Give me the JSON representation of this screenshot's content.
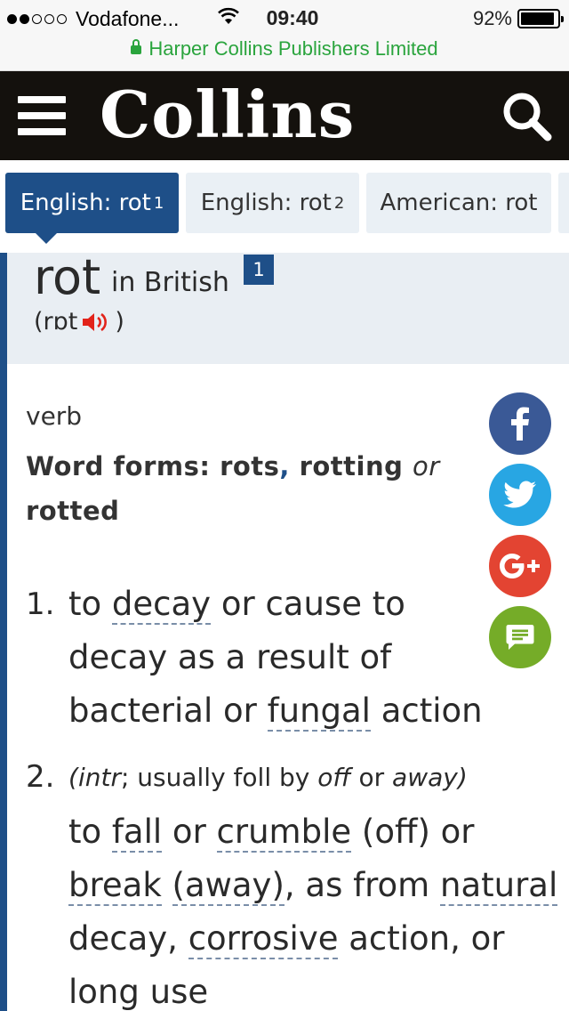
{
  "status_bar": {
    "carrier": "Vodafone...",
    "time": "09:40",
    "battery": "92%",
    "signal_bars_filled": 2,
    "signal_bars_total": 5
  },
  "url_bar": {
    "site_label": "Harper Collins Publishers Limited",
    "lock_icon": "lock-icon"
  },
  "header": {
    "logo": "Collins",
    "menu_icon": "hamburger-menu-icon",
    "search_icon": "search-icon"
  },
  "tabs": [
    {
      "label": "English: rot",
      "superscript": "1",
      "active": true
    },
    {
      "label": "English: rot",
      "superscript": "2",
      "active": false
    },
    {
      "label": "American: rot",
      "superscript": "",
      "active": false
    }
  ],
  "entry": {
    "headword": "rot",
    "region": "in British",
    "homograph": "1",
    "pronunciation_open": "(rɒt",
    "pronunciation_close": ")",
    "audio_icon": "speaker-icon"
  },
  "definition": {
    "part_of_speech": "verb",
    "word_forms_label": "Word forms:",
    "word_forms": [
      "rots",
      "rotting"
    ],
    "word_forms_separator": ",",
    "word_forms_or": "or",
    "word_forms_last": "rotted",
    "senses": [
      {
        "number": "1.",
        "line1": {
          "a": "to ",
          "link1": "decay",
          "b": " or cause to"
        },
        "line2": "decay as a result of",
        "line3": {
          "a": "bacterial or ",
          "link1": "fungal",
          "b": " action"
        }
      },
      {
        "number": "2.",
        "label": {
          "open": "(",
          "intr": "intr",
          "semicolon": "; usually foll by ",
          "off": "off",
          "or": " or ",
          "away": "away",
          "close": ")"
        },
        "line1": {
          "a": "to ",
          "link1": "fall",
          "b": " or ",
          "link2": "crumble",
          "c": " (off) or"
        },
        "line2": {
          "link1": "break",
          "a": " ",
          "link2": "(away)",
          "b": ", as from ",
          "link3": "natural"
        },
        "line3": {
          "a": "decay, ",
          "link1": "corrosive",
          "b": " action, or"
        },
        "line4": "long use"
      }
    ]
  },
  "share_buttons": [
    {
      "name": "facebook",
      "icon": "facebook-icon",
      "color": "#3a5996"
    },
    {
      "name": "twitter",
      "icon": "twitter-icon",
      "color": "#28a6e3"
    },
    {
      "name": "google-plus",
      "icon": "google-plus-icon",
      "color": "#e34432"
    },
    {
      "name": "comment",
      "icon": "comment-icon",
      "color": "#75ac28"
    }
  ],
  "colors": {
    "brand_blue": "#1e4f88",
    "header_black": "#14110d",
    "secure_green": "#2aa43d",
    "speaker_red": "#e2231a"
  }
}
